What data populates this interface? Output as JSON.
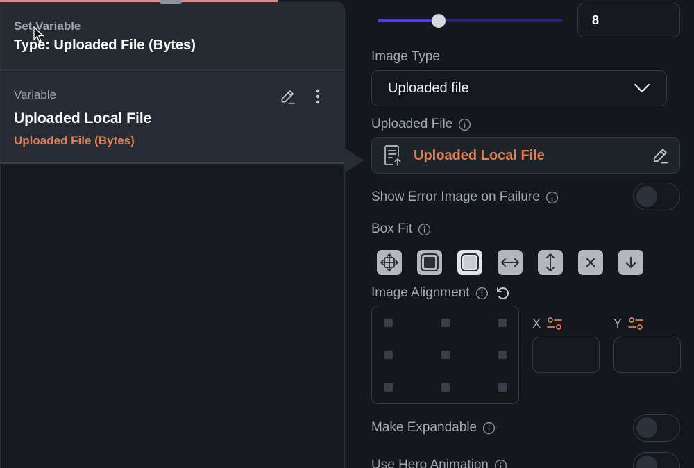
{
  "set_variable": {
    "kicker": "Set Variable",
    "title": "Type: Uploaded File (Bytes)"
  },
  "variable_card": {
    "label": "Variable",
    "name": "Uploaded Local File",
    "type": "Uploaded File (Bytes)"
  },
  "properties": {
    "slider": {
      "value_fraction": 0.33,
      "input_value": "8"
    },
    "image_type": {
      "label": "Image Type",
      "selected": "Uploaded file"
    },
    "uploaded_file": {
      "label": "Uploaded File",
      "value": "Uploaded Local File"
    },
    "show_error_image": {
      "label": "Show Error Image on Failure",
      "enabled": false
    },
    "box_fit": {
      "label": "Box Fit",
      "options": [
        "contain-icon",
        "cover-icon",
        "fill-icon",
        "fit-width-icon",
        "fit-height-icon",
        "none-icon",
        "scale-down-icon"
      ]
    },
    "image_alignment": {
      "label": "Image Alignment",
      "x_label": "X",
      "y_label": "Y",
      "x_value": "",
      "y_value": ""
    },
    "make_expandable": {
      "label": "Make Expandable",
      "enabled": false
    },
    "use_hero_animation": {
      "label": "Use Hero Animation",
      "enabled": false
    }
  },
  "colors": {
    "accent_orange": "#e07e54",
    "slider_fill": "#4d3de4",
    "panel_bg": "#14171c",
    "card_bg": "#272b33"
  }
}
